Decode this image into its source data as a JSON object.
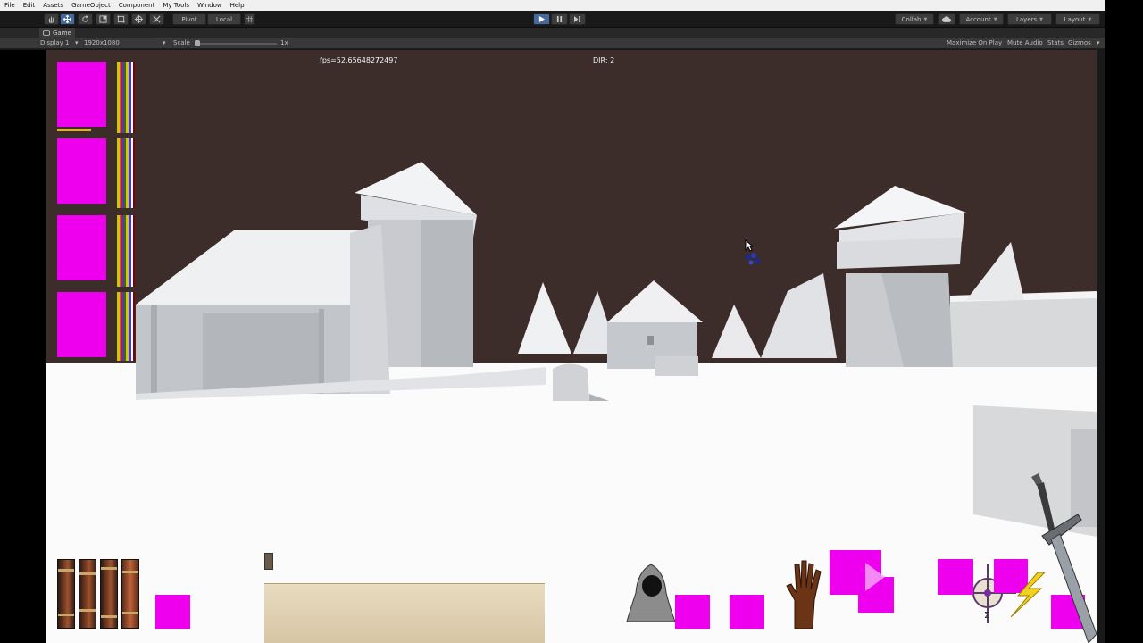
{
  "menu": [
    "File",
    "Edit",
    "Assets",
    "GameObject",
    "Component",
    "My Tools",
    "Window",
    "Help"
  ],
  "toolbar": {
    "pivot_label": "Pivot",
    "local_label": "Local",
    "collab_label": "Collab",
    "account_label": "Account",
    "layers_label": "Layers",
    "layout_label": "Layout"
  },
  "game_tab": {
    "title": "Game",
    "display": "Display 1",
    "resolution": "1920x1080",
    "scale_label": "Scale",
    "scale_value": "1x",
    "maximize_on_play": "Maximize On Play",
    "mute_audio": "Mute Audio",
    "stats": "Stats",
    "gizmos": "Gizmos"
  },
  "hud": {
    "fps": "fps=52.6564827",
    "fps_overlap": "72497",
    "dir": "DIR: 2"
  },
  "colors": {
    "sky": "#3c2d2b",
    "ground": "#fbfbfb",
    "missing_texture": "#ee00ee",
    "play_active": "#466a9c"
  },
  "icons": [
    "hand-tool-icon",
    "move-tool-icon",
    "rotate-tool-icon",
    "scale-tool-icon",
    "rect-tool-icon",
    "transform-tool-icon",
    "custom-tool-icon",
    "play-icon",
    "pause-icon",
    "step-icon",
    "cloud-icon",
    "hooded-figure-icon",
    "hand-icon",
    "sword-icon",
    "lightning-icon"
  ]
}
